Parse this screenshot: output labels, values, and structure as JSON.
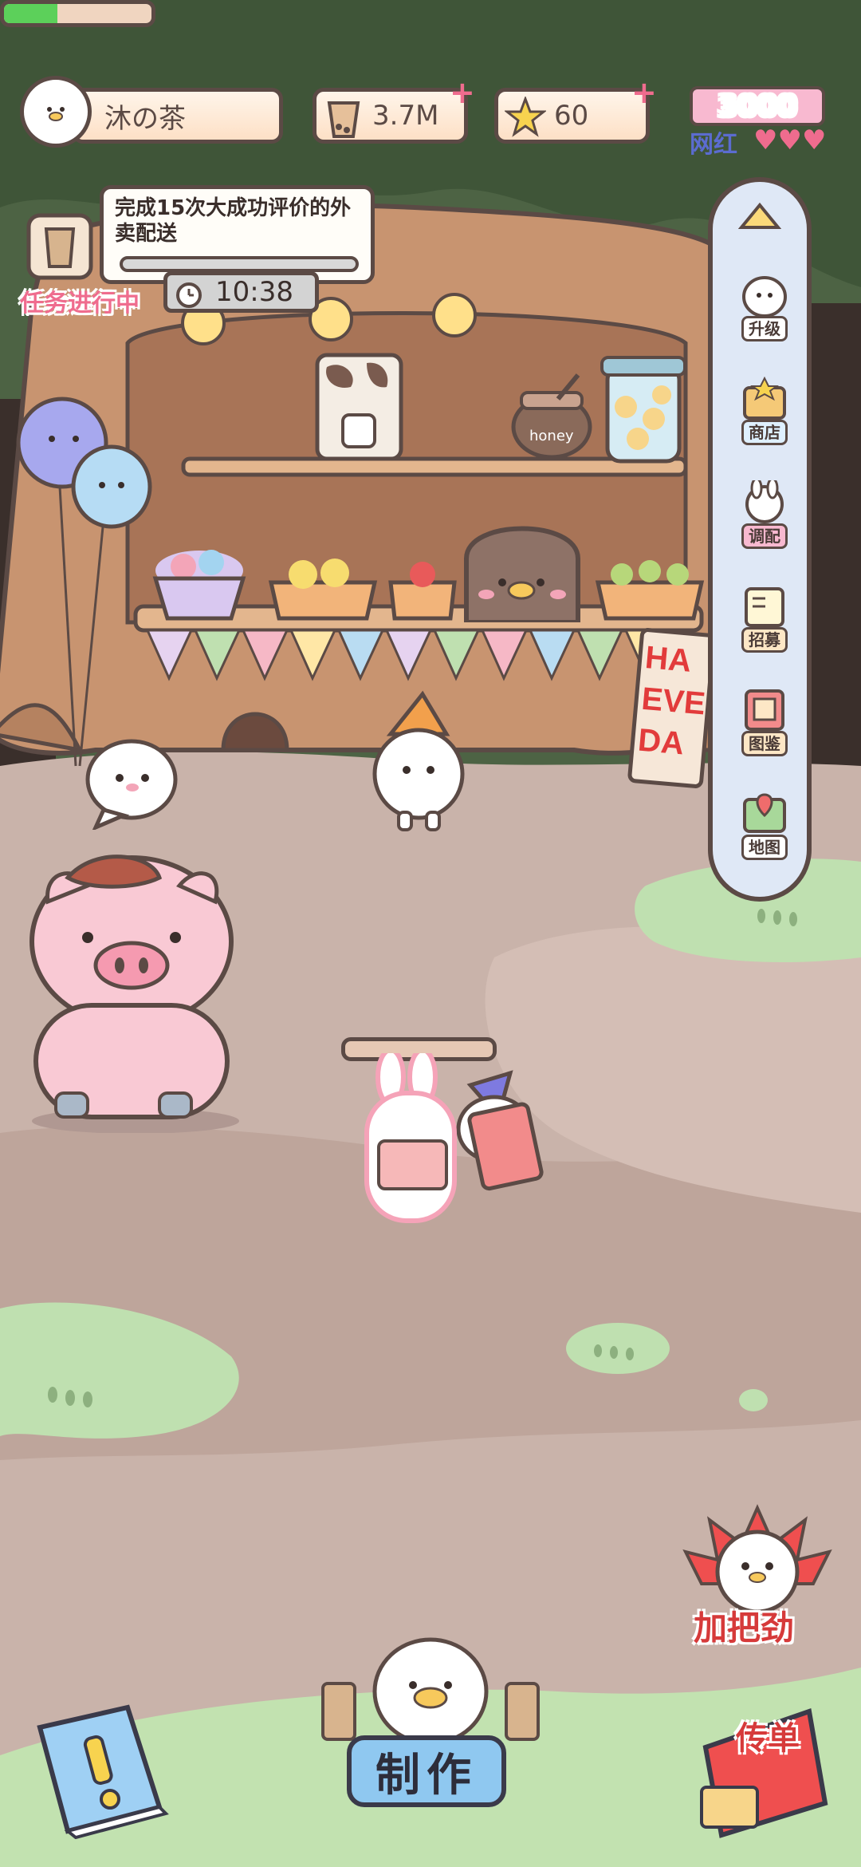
{
  "hud": {
    "player_name": "沐の茶",
    "coins": "3.7M",
    "stars": "60",
    "promo_top": "3000",
    "promo_bottom": "网红"
  },
  "task": {
    "description": "完成15次大成功评价的外卖配送",
    "status": "任务进行中",
    "timer": "10:38",
    "progress": 0
  },
  "sidebar": {
    "items": [
      {
        "label": "升级",
        "icon": "level-up-icon"
      },
      {
        "label": "商店",
        "icon": "shop-icon"
      },
      {
        "label": "调配",
        "icon": "mix-icon"
      },
      {
        "label": "招募",
        "icon": "recruit-icon"
      },
      {
        "label": "图鉴",
        "icon": "collection-book-icon"
      },
      {
        "label": "地图",
        "icon": "map-icon"
      }
    ]
  },
  "shop": {
    "honey_label": "honey",
    "banner_text": "HAPPY EVERY DAY",
    "banner_lines": [
      "HA",
      "EVE",
      "DA"
    ],
    "chef_progress": 0.36
  },
  "actions": {
    "cheer_label": "加把劲",
    "make_label": "制作",
    "flyer_label": "传单"
  },
  "colors": {
    "forest": "#4d6344",
    "ground": "#c9b3aa",
    "grass": "#bfe0b0",
    "trunk": "#c89470",
    "accent_pink": "#ef6c8e",
    "button_blue": "#8fc8f0"
  }
}
